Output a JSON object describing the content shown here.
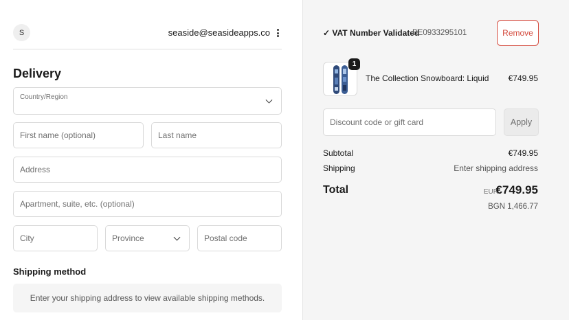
{
  "header": {
    "avatar_initial": "S",
    "email": "seaside@seasideapps.co"
  },
  "delivery": {
    "title": "Delivery",
    "country_label": "Country/Region",
    "first_name_placeholder": "First name (optional)",
    "last_name_placeholder": "Last name",
    "address_placeholder": "Address",
    "apartment_placeholder": "Apartment, suite, etc. (optional)",
    "city_placeholder": "City",
    "province_placeholder": "Province",
    "postal_placeholder": "Postal code"
  },
  "shipping": {
    "title": "Shipping method",
    "message": "Enter your shipping address to view available shipping methods."
  },
  "vat": {
    "status": "✓ VAT Number Validated",
    "number": "BE0933295101",
    "remove_label": "Remove"
  },
  "cart": {
    "items": [
      {
        "name": "The Collection Snowboard: Liquid",
        "price": "€749.95",
        "quantity": "1"
      }
    ]
  },
  "discount": {
    "placeholder": "Discount code or gift card",
    "apply_label": "Apply"
  },
  "summary": {
    "subtotal_label": "Subtotal",
    "subtotal_value": "€749.95",
    "shipping_label": "Shipping",
    "shipping_value": "Enter shipping address",
    "total_label": "Total",
    "currency": "EUR",
    "total_value": "€749.95",
    "alt_total": "BGN 1,466.77"
  },
  "colors": {
    "remove_accent": "#d44a3d",
    "summary_bg": "#f5f5f5"
  }
}
